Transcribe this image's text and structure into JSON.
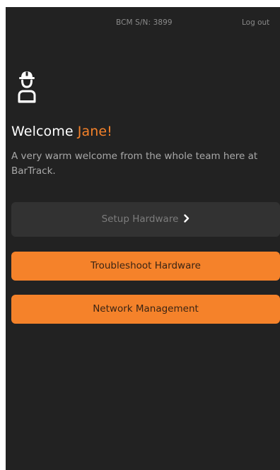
{
  "header": {
    "serial": "BCM S/N: 3899",
    "logout_label": "Log out"
  },
  "welcome": {
    "greeting": "Welcome",
    "name": "Jane!",
    "message": "A very warm welcome from the whole team here at BarTrack."
  },
  "actions": {
    "setup_label": "Setup Hardware",
    "troubleshoot_label": "Troubleshoot Hardware",
    "network_label": "Network Management"
  },
  "icons": {
    "avatar": "worker-hardhat-icon",
    "setup_chevron": "chevron-right-icon"
  },
  "colors": {
    "background": "#222222",
    "accent": "#f5822a",
    "disabled_button": "#323232"
  }
}
